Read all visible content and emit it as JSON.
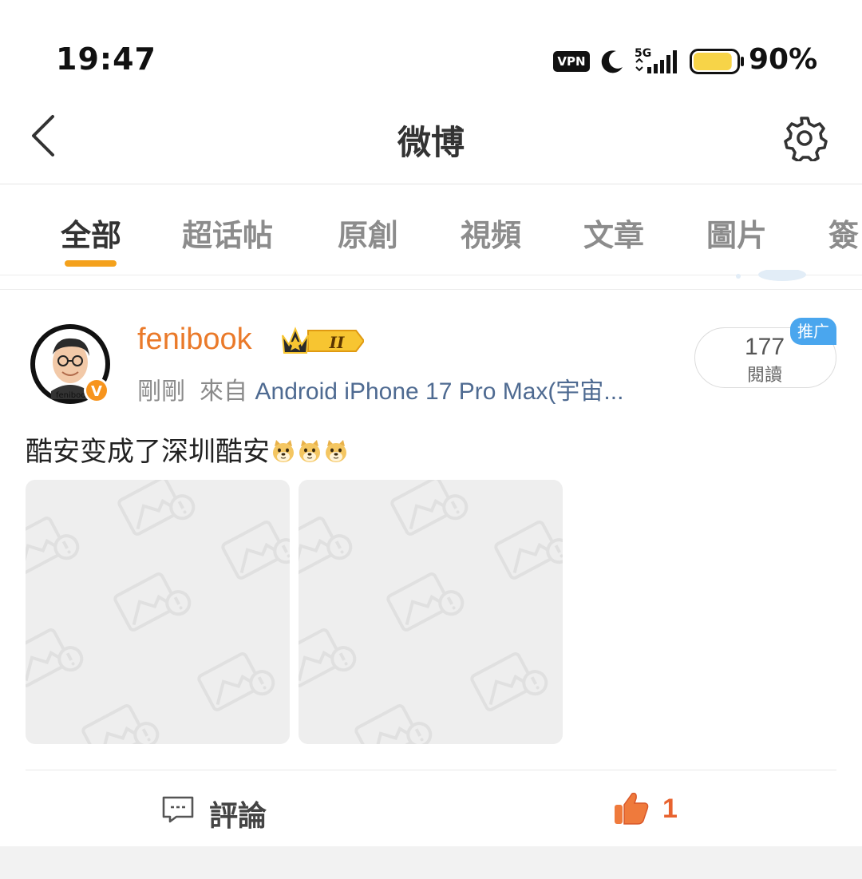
{
  "status_bar": {
    "time": "19:47",
    "vpn": "VPN",
    "network": "5G",
    "battery_percent": "90%",
    "battery_level": 0.9,
    "battery_color": "#f7d448"
  },
  "header": {
    "title": "微博",
    "back_icon": "chevron-left-icon",
    "settings_icon": "gear-icon"
  },
  "tabs": [
    {
      "label": "全部",
      "active": true
    },
    {
      "label": "超话帖",
      "active": false
    },
    {
      "label": "原創",
      "active": false
    },
    {
      "label": "視頻",
      "active": false
    },
    {
      "label": "文章",
      "active": false
    },
    {
      "label": "圖片",
      "active": false
    },
    {
      "label": "簽",
      "active": false
    }
  ],
  "colors": {
    "accent": "#f4a11c",
    "username": "#ea7a2a",
    "source_link": "#4e6a91",
    "promo": "#4aa6ee",
    "like": "#e8632f"
  },
  "post": {
    "username": "fenibook",
    "avatar_caption": "fenibook",
    "verified_badge": "V",
    "member_badge": "II",
    "time": "剛剛",
    "from_word": "來自",
    "source": "Android iPhone 17 Pro Max(宇宙...",
    "read_count": "177",
    "read_label": "閱讀",
    "promo_tag": "推广",
    "text": "酷安变成了深圳酷安",
    "emoji_count": 3,
    "images": [
      {
        "state": "placeholder"
      },
      {
        "state": "placeholder"
      }
    ],
    "comment_label": "評論",
    "like_count": "1"
  }
}
